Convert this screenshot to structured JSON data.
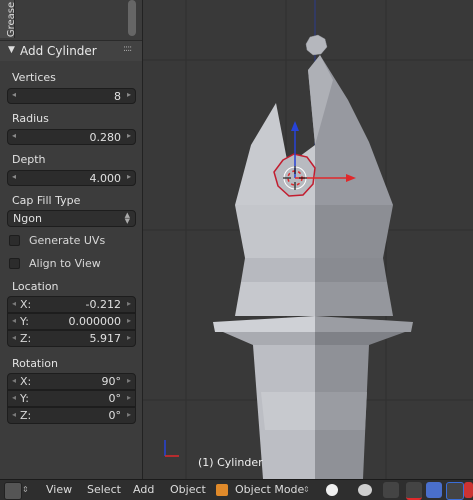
{
  "panel": {
    "tab_label": "Grease",
    "operator_title": "Add Cylinder",
    "vertices": {
      "label": "Vertices",
      "value": "8"
    },
    "radius": {
      "label": "Radius",
      "value": "0.280"
    },
    "depth": {
      "label": "Depth",
      "value": "4.000"
    },
    "cap_fill": {
      "label": "Cap Fill Type",
      "value": "Ngon"
    },
    "generate_uvs": {
      "label": "Generate UVs",
      "checked": false
    },
    "align_to_view": {
      "label": "Align to View",
      "checked": false
    },
    "location": {
      "label": "Location",
      "x": {
        "label": "X:",
        "value": "-0.212"
      },
      "y": {
        "label": "Y:",
        "value": "0.000000"
      },
      "z": {
        "label": "Z:",
        "value": "5.917"
      }
    },
    "rotation": {
      "label": "Rotation",
      "x": {
        "label": "X:",
        "value": "90°"
      },
      "y": {
        "label": "Y:",
        "value": "0°"
      },
      "z": {
        "label": "Z:",
        "value": "0°"
      }
    }
  },
  "viewport": {
    "object_label": "(1) Cylinder"
  },
  "header": {
    "view": "View",
    "select": "Select",
    "add": "Add",
    "object": "Object",
    "mode": "Object Mode"
  },
  "colors": {
    "manipulator_red": "#e0292b",
    "manipulator_blue": "#2743d8",
    "selection_outline": "#c21d2f",
    "mesh_light": "#bfc1c7",
    "mesh_dark": "#8e9097"
  }
}
